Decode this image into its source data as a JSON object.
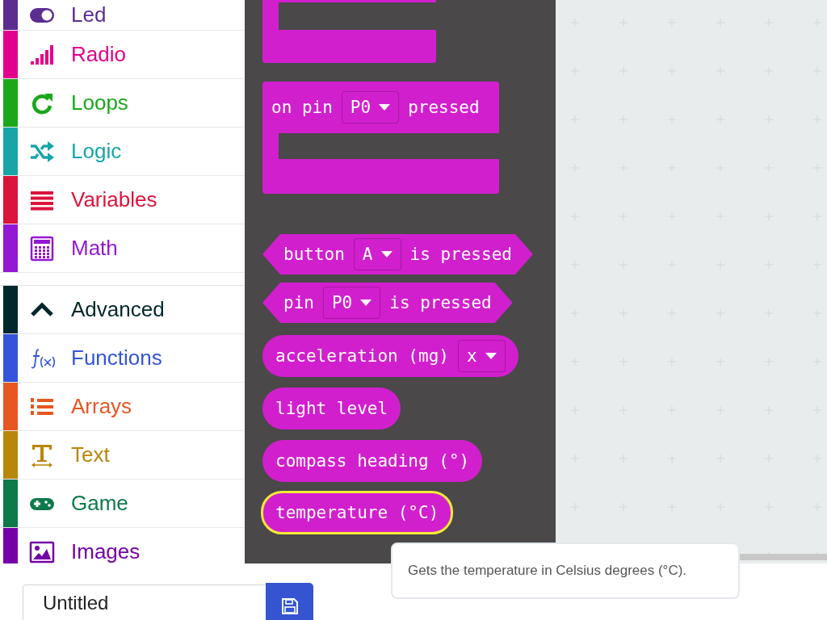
{
  "sidebar": {
    "categories": [
      {
        "label": "Led",
        "color": "#5c2d91"
      },
      {
        "label": "Radio",
        "color": "#e3008c"
      },
      {
        "label": "Loops",
        "color": "#1aa81a"
      },
      {
        "label": "Logic",
        "color": "#19a5a8"
      },
      {
        "label": "Variables",
        "color": "#dc143c"
      },
      {
        "label": "Math",
        "color": "#9418d3"
      }
    ],
    "advanced": {
      "label": "Advanced",
      "color": "#00272b",
      "expanded": true
    },
    "advanced_categories": [
      {
        "label": "Functions",
        "color": "#3455db"
      },
      {
        "label": "Arrays",
        "color": "#e65722"
      },
      {
        "label": "Text",
        "color": "#b8860b"
      },
      {
        "label": "Game",
        "color": "#0e7a4b"
      },
      {
        "label": "Images",
        "color": "#7600a8"
      }
    ]
  },
  "flyout": {
    "blocks": [
      {
        "kind": "c_partial",
        "selected": false
      },
      {
        "kind": "event",
        "selected": false,
        "parts": [
          {
            "kind": "label",
            "text": "on pin"
          },
          {
            "kind": "dropdown",
            "text": "P0"
          },
          {
            "kind": "label",
            "text": "pressed"
          }
        ]
      },
      {
        "kind": "boolean",
        "selected": false,
        "parts": [
          {
            "kind": "label",
            "text": "button"
          },
          {
            "kind": "dropdown",
            "text": "A"
          },
          {
            "kind": "label",
            "text": "is pressed"
          }
        ]
      },
      {
        "kind": "boolean",
        "selected": false,
        "parts": [
          {
            "kind": "label",
            "text": "pin"
          },
          {
            "kind": "dropdown",
            "text": "P0"
          },
          {
            "kind": "label",
            "text": "is pressed"
          }
        ]
      },
      {
        "kind": "reporter",
        "selected": false,
        "parts": [
          {
            "kind": "label",
            "text": "acceleration (mg)"
          },
          {
            "kind": "dropdown",
            "text": "x"
          }
        ]
      },
      {
        "kind": "reporter",
        "selected": false,
        "parts": [
          {
            "kind": "label",
            "text": "light level"
          }
        ]
      },
      {
        "kind": "reporter",
        "selected": false,
        "parts": [
          {
            "kind": "label",
            "text": "compass heading (°)"
          }
        ]
      },
      {
        "kind": "reporter",
        "selected": true,
        "parts": [
          {
            "kind": "label",
            "text": "temperature (°C)"
          }
        ]
      }
    ]
  },
  "tooltip": {
    "text": "Gets the temperature in Celsius degrees (°C)."
  },
  "project": {
    "name_field": {
      "value": "Untitled"
    }
  }
}
